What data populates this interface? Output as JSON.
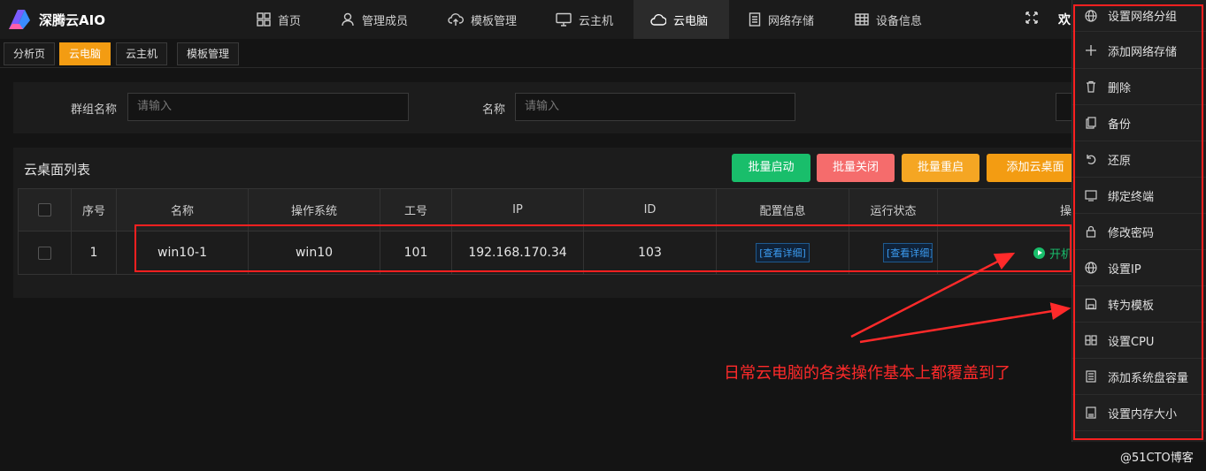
{
  "app": {
    "name": "深腾云AIO"
  },
  "nav": {
    "items": [
      {
        "label": "首页",
        "icon": "grid-icon"
      },
      {
        "label": "管理成员",
        "icon": "user-icon"
      },
      {
        "label": "模板管理",
        "icon": "cloud-upload-icon"
      },
      {
        "label": "云主机",
        "icon": "monitor-icon"
      },
      {
        "label": "云电脑",
        "icon": "cloud-icon",
        "active": true
      },
      {
        "label": "网络存储",
        "icon": "document-icon"
      },
      {
        "label": "设备信息",
        "icon": "table-icon"
      }
    ],
    "right_text": "欢"
  },
  "tabs": [
    {
      "label": "分析页"
    },
    {
      "label": "云电脑",
      "active": true
    },
    {
      "label": "云主机"
    },
    {
      "label": "模板管理"
    }
  ],
  "search": {
    "group_label": "群组名称",
    "group_placeholder": "请输入",
    "name_label": "名称",
    "name_placeholder": "请输入"
  },
  "list": {
    "title": "云桌面列表",
    "buttons": {
      "batch_start": "批量启动",
      "batch_stop": "批量关闭",
      "batch_restart": "批量重启",
      "add_desktop": "添加云桌面"
    },
    "columns": [
      "序号",
      "名称",
      "操作系统",
      "工号",
      "IP",
      "ID",
      "配置信息",
      "运行状态",
      "操作"
    ],
    "rows": [
      {
        "index": "1",
        "name": "win10-1",
        "os": "win10",
        "employee_no": "101",
        "ip": "192.168.170.34",
        "id": "103",
        "config": "[查看详细]",
        "status": "[查看详细]",
        "action": "开机"
      }
    ]
  },
  "menu": {
    "items": [
      {
        "label": "设置网络分组",
        "icon": "globe-icon"
      },
      {
        "label": "添加网络存储",
        "icon": "plus-icon"
      },
      {
        "label": "删除",
        "icon": "trash-icon"
      },
      {
        "label": "备份",
        "icon": "copy-icon"
      },
      {
        "label": "还原",
        "icon": "undo-icon"
      },
      {
        "label": "绑定终端",
        "icon": "terminal-icon"
      },
      {
        "label": "修改密码",
        "icon": "lock-icon"
      },
      {
        "label": "设置IP",
        "icon": "globe-icon"
      },
      {
        "label": "转为模板",
        "icon": "save-icon"
      },
      {
        "label": "设置CPU",
        "icon": "cpu-icon"
      },
      {
        "label": "添加系统盘容量",
        "icon": "disk-icon"
      },
      {
        "label": "设置内存大小",
        "icon": "memory-icon"
      }
    ]
  },
  "annotation": "日常云电脑的各类操作基本上都覆盖到了",
  "watermark": "@51CTO博客",
  "colors": {
    "accent_orange": "#f39c12",
    "green": "#19be6b",
    "red": "#f56c6c",
    "annotation_red": "#ff2a2a"
  }
}
